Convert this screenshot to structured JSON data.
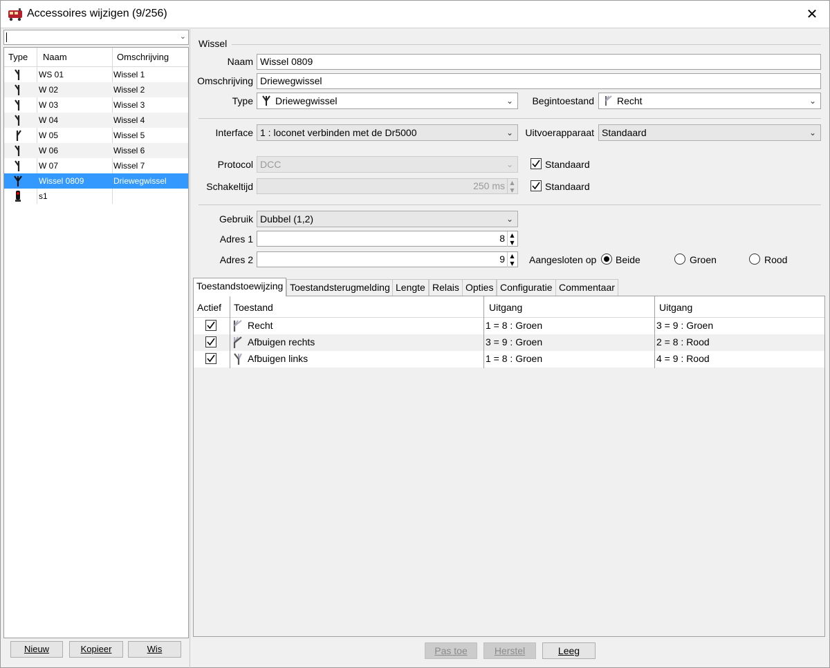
{
  "window": {
    "title": "Accessoires wijzigen (9/256)",
    "close_glyph": "✕"
  },
  "left": {
    "filter_value": "",
    "columns": [
      "Type",
      "Naam",
      "Omschrijving"
    ],
    "rows": [
      {
        "icon": "turnout-icon",
        "naam": "WS 01",
        "omschrijving": "Wissel 1"
      },
      {
        "icon": "turnout-icon",
        "naam": "W 02",
        "omschrijving": "Wissel 2"
      },
      {
        "icon": "turnout-icon",
        "naam": "W 03",
        "omschrijving": "Wissel 3"
      },
      {
        "icon": "turnout-icon",
        "naam": "W 04",
        "omschrijving": "Wissel 4"
      },
      {
        "icon": "turnout-icon",
        "naam": "W 05",
        "omschrijving": "Wissel 5"
      },
      {
        "icon": "turnout-icon",
        "naam": "W 06",
        "omschrijving": "Wissel 6"
      },
      {
        "icon": "turnout-icon",
        "naam": "W 07",
        "omschrijving": "Wissel 7"
      },
      {
        "icon": "three-way-turnout-icon",
        "naam": "Wissel 0809",
        "omschrijving": "Driewegwissel"
      },
      {
        "icon": "signal-icon",
        "naam": "s1",
        "omschrijving": ""
      }
    ],
    "selected_index": 7,
    "buttons": {
      "nieuw": "Nieuw",
      "kopieer": "Kopieer",
      "wis": "Wis"
    }
  },
  "form": {
    "section_title": "Wissel",
    "naam_label": "Naam",
    "naam_value": "Wissel 0809",
    "omschrijving_label": "Omschrijving",
    "omschrijving_value": "Driewegwissel",
    "type_label": "Type",
    "type_value": "Driewegwissel",
    "begintoestand_label": "Begintoestand",
    "begintoestand_value": "Recht",
    "interface_label": "Interface",
    "interface_value": "1 : loconet  verbinden met de Dr5000",
    "uitvoerapparaat_label": "Uitvoerapparaat",
    "uitvoerapparaat_value": "Standaard",
    "protocol_label": "Protocol",
    "protocol_value": "DCC",
    "protocol_std_label": "Standaard",
    "protocol_std_checked": true,
    "schakeltijd_label": "Schakeltijd",
    "schakeltijd_value": "250 ms",
    "schakeltijd_std_label": "Standaard",
    "schakeltijd_std_checked": true,
    "gebruik_label": "Gebruik",
    "gebruik_value": "Dubbel (1,2)",
    "adres1_label": "Adres 1",
    "adres1_value": "8",
    "adres2_label": "Adres 2",
    "adres2_value": "9",
    "aangesloten_label": "Aangesloten op",
    "radio_options": [
      "Beide",
      "Groen",
      "Rood"
    ],
    "radio_selected": "Beide"
  },
  "tabs": [
    "Toestandstoewijzing",
    "Toestandsterugmelding",
    "Lengte",
    "Relais",
    "Opties",
    "Configuratie",
    "Commentaar"
  ],
  "active_tab": "Toestandstoewijzing",
  "table": {
    "columns": [
      "Actief",
      "Toestand",
      "Uitgang",
      "Uitgang"
    ],
    "rows": [
      {
        "actief": true,
        "icon": "straight-icon",
        "toestand": "Recht",
        "uitgang1": "1 = 8 : Groen",
        "uitgang2": "3 = 9 : Groen"
      },
      {
        "actief": true,
        "icon": "diverge-right-icon",
        "toestand": "Afbuigen rechts",
        "uitgang1": "3 = 9 : Groen",
        "uitgang2": "2 = 8 : Rood"
      },
      {
        "actief": true,
        "icon": "diverge-left-icon",
        "toestand": "Afbuigen links",
        "uitgang1": "1 = 8 : Groen",
        "uitgang2": "4 = 9 : Rood"
      }
    ]
  },
  "bottom_buttons": {
    "pas_toe": "Pas toe",
    "herstel": "Herstel",
    "leeg": "Leeg"
  },
  "colors": {
    "selection": "#3399ff",
    "window_bg": "#f0f0f0"
  }
}
